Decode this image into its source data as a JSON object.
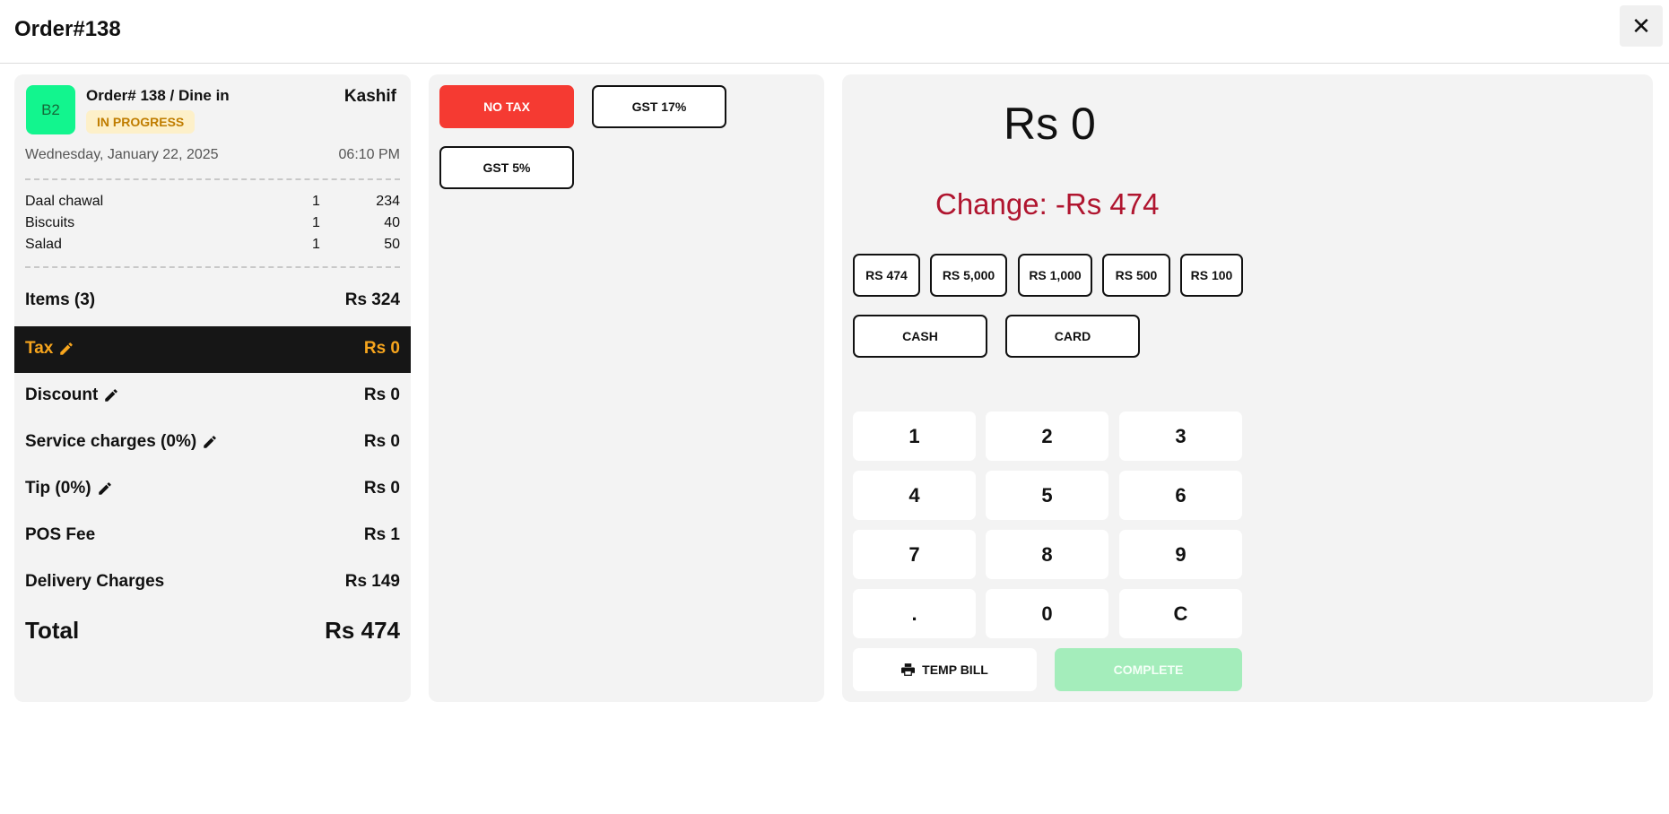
{
  "header": {
    "title": "Order#138",
    "close_label": "✕"
  },
  "order": {
    "table": "B2",
    "order_line": "Order# 138 / Dine in",
    "status": "IN PROGRESS",
    "waiter": "Kashif",
    "date": "Wednesday, January 22, 2025",
    "time": "06:10 PM",
    "items": [
      {
        "name": "Daal chawal",
        "qty": "1",
        "price": "234"
      },
      {
        "name": "Biscuits",
        "qty": "1",
        "price": "40"
      },
      {
        "name": "Salad",
        "qty": "1",
        "price": "50"
      }
    ]
  },
  "summary": {
    "items_label": "Items (3)",
    "items_value": "Rs 324",
    "tax_label": "Tax",
    "tax_value": "Rs 0",
    "discount_label": "Discount",
    "discount_value": "Rs 0",
    "service_label": "Service charges (0%)",
    "service_value": "Rs 0",
    "tip_label": "Tip (0%)",
    "tip_value": "Rs 0",
    "pos_label": "POS Fee",
    "pos_value": "Rs 1",
    "delivery_label": "Delivery Charges",
    "delivery_value": "Rs 149",
    "total_label": "Total",
    "total_value": "Rs 474"
  },
  "tax_options": {
    "no_tax": "NO TAX",
    "gst17": "GST 17%",
    "gst5": "GST 5%"
  },
  "payment": {
    "amount": "Rs 0",
    "change": "Change: -Rs 474",
    "quick_amounts": [
      "RS 474",
      "RS 5,000",
      "RS 1,000",
      "RS 500",
      "RS 100"
    ],
    "cash_label": "CASH",
    "card_label": "CARD",
    "keys": [
      "1",
      "2",
      "3",
      "4",
      "5",
      "6",
      "7",
      "8",
      "9",
      ".",
      "0",
      "C"
    ],
    "temp_bill_label": "TEMP BILL",
    "complete_label": "COMPLETE"
  },
  "colors": {
    "accent_red": "#f53a32",
    "tax_orange": "#f7a51d",
    "change_red": "#b0152f",
    "table_green": "#12f58e",
    "complete_green": "#a4edbb"
  }
}
